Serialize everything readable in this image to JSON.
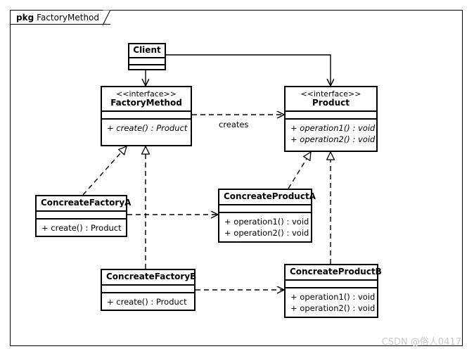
{
  "diagram": {
    "package": {
      "keyword": "pkg",
      "name": "FactoryMethod"
    },
    "watermark": "CSDN @俗人0417",
    "colors": {
      "line": "#000000",
      "background": "#ffffff",
      "watermark": "#c8c8c8"
    },
    "nodes": [
      {
        "id": "client",
        "name": "Client",
        "stereotype": "",
        "attributes": [],
        "operations": []
      },
      {
        "id": "factorymethod",
        "name": "FactoryMethod",
        "stereotype": "<<interface>>",
        "attributes": [],
        "operations": [
          "+ create() : Product"
        ]
      },
      {
        "id": "product",
        "name": "Product",
        "stereotype": "<<interface>>",
        "attributes": [],
        "operations": [
          "+ operation1() : void",
          "+ operation2() : void"
        ]
      },
      {
        "id": "concreatefactorya",
        "name": "ConcreateFactoryA",
        "stereotype": "",
        "attributes": [],
        "operations": [
          "+ create() : Product"
        ]
      },
      {
        "id": "concreateproducta",
        "name": "ConcreateProductA",
        "stereotype": "",
        "attributes": [],
        "operations": [
          "+ operation1() : void",
          "+ operation2() : void"
        ]
      },
      {
        "id": "concreatefactoryb",
        "name": "ConcreateFactoryB",
        "stereotype": "",
        "attributes": [],
        "operations": [
          "+ create() : Product"
        ]
      },
      {
        "id": "concreateproductb",
        "name": "ConcreateProductB",
        "stereotype": "",
        "attributes": [],
        "operations": [
          "+ operation1() : void",
          "+ operation2() : void"
        ]
      }
    ],
    "edges": [
      {
        "id": "client-factorymethod",
        "from": "client",
        "to": "factorymethod",
        "type": "association",
        "label": ""
      },
      {
        "id": "client-product",
        "from": "client",
        "to": "product",
        "type": "association",
        "label": ""
      },
      {
        "id": "factorymethod-product",
        "from": "factorymethod",
        "to": "product",
        "type": "dependency",
        "label": "creates"
      },
      {
        "id": "concreatefactorya-factorymethod",
        "from": "concreatefactorya",
        "to": "factorymethod",
        "type": "realization",
        "label": ""
      },
      {
        "id": "concreatefactoryb-factorymethod",
        "from": "concreatefactoryb",
        "to": "factorymethod",
        "type": "realization",
        "label": ""
      },
      {
        "id": "concreateproducta-product",
        "from": "concreateproducta",
        "to": "product",
        "type": "realization",
        "label": ""
      },
      {
        "id": "concreateproductb-product",
        "from": "concreateproductb",
        "to": "product",
        "type": "realization",
        "label": ""
      },
      {
        "id": "concreatefactorya-concreateproducta",
        "from": "concreatefactorya",
        "to": "concreateproducta",
        "type": "dependency",
        "label": ""
      },
      {
        "id": "concreatefactoryb-concreateproductb",
        "from": "concreatefactoryb",
        "to": "concreateproductb",
        "type": "dependency",
        "label": ""
      }
    ]
  }
}
